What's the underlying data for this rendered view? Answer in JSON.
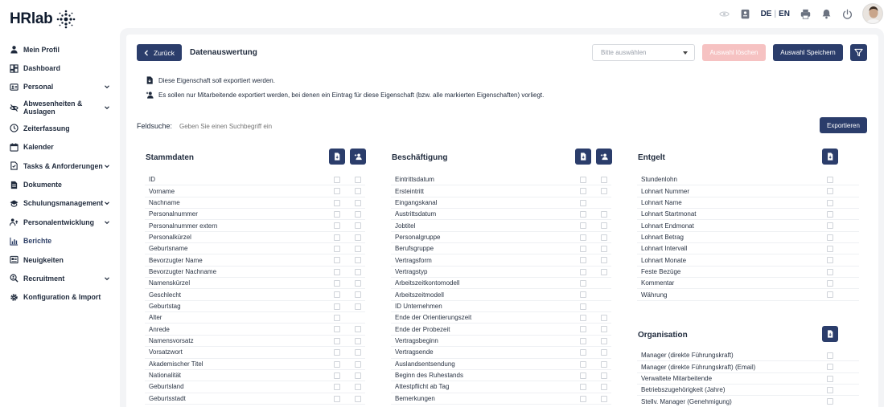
{
  "brand": {
    "name": "HRlab",
    "accent": "#2b3d6b",
    "danger_soft": "#f6c2c2"
  },
  "topbar": {
    "icons": [
      "eye-icon",
      "id-card-icon",
      "printer-icon",
      "bell-icon",
      "power-icon"
    ],
    "lang_de": "DE",
    "lang_sep": "|",
    "lang_en": "EN"
  },
  "sidebar": {
    "items": [
      {
        "label": "Mein Profil",
        "icon": "user-icon",
        "chevron": false
      },
      {
        "label": "Dashboard",
        "icon": "dashboard-icon",
        "chevron": false
      },
      {
        "label": "Personal",
        "icon": "people-icon",
        "chevron": true
      },
      {
        "label": "Abwesenheiten & Auslagen",
        "icon": "eye-off-icon",
        "chevron": true
      },
      {
        "label": "Zeiterfassung",
        "icon": "clock-icon",
        "chevron": false
      },
      {
        "label": "Kalender",
        "icon": "calendar-icon",
        "chevron": false
      },
      {
        "label": "Tasks & Anforderungen",
        "icon": "tasks-icon",
        "chevron": true
      },
      {
        "label": "Dokumente",
        "icon": "document-icon",
        "chevron": false
      },
      {
        "label": "Schulungsmanagement",
        "icon": "graduation-icon",
        "chevron": true
      },
      {
        "label": "Personalentwicklung",
        "icon": "growth-icon",
        "chevron": true
      },
      {
        "label": "Berichte",
        "icon": "chart-icon",
        "chevron": false,
        "active": true
      },
      {
        "label": "Neuigkeiten",
        "icon": "news-icon",
        "chevron": false
      },
      {
        "label": "Recruitment",
        "icon": "search-person-icon",
        "chevron": true
      },
      {
        "label": "Konfiguration & Import",
        "icon": "gear-icon",
        "chevron": false
      }
    ]
  },
  "toolbar": {
    "back_label": "Zurück",
    "title": "Datenauswertung",
    "select_placeholder": "Bitte auswählen",
    "delete_label": "Auswahl löschen",
    "save_label": "Auswahl Speichern"
  },
  "legend": {
    "export_text": "Diese Eigenschaft soll exportiert werden.",
    "filter_text": "Es sollen nur Mitarbeitende exportiert werden, bei denen ein Eintrag für diese Eigenschaft (bzw. alle markierten Eigenschaften) vorliegt."
  },
  "search": {
    "label": "Feldsuche:",
    "placeholder": "Geben Sie einen Suchbegriff ein",
    "export_label": "Exportieren"
  },
  "sections": {
    "stammdaten": {
      "title": "Stammdaten",
      "rows": [
        {
          "label": "ID",
          "second": true
        },
        {
          "label": "Vorname",
          "second": true
        },
        {
          "label": "Nachname",
          "second": true
        },
        {
          "label": "Personalnummer",
          "second": true
        },
        {
          "label": "Personalnummer extern",
          "second": true
        },
        {
          "label": "Personalkürzel",
          "second": true
        },
        {
          "label": "Geburtsname",
          "second": true
        },
        {
          "label": "Bevorzugter Name",
          "second": true
        },
        {
          "label": "Bevorzugter Nachname",
          "second": true
        },
        {
          "label": "Namenskürzel",
          "second": true
        },
        {
          "label": "Geschlecht",
          "second": true
        },
        {
          "label": "Geburtstag",
          "second": true
        },
        {
          "label": "Alter",
          "second": false
        },
        {
          "label": "Anrede",
          "second": true
        },
        {
          "label": "Namensvorsatz",
          "second": true
        },
        {
          "label": "Vorsatzwort",
          "second": true
        },
        {
          "label": "Akademischer Titel",
          "second": true
        },
        {
          "label": "Nationalität",
          "second": true
        },
        {
          "label": "Geburtsland",
          "second": true
        },
        {
          "label": "Geburtsstadt",
          "second": true
        }
      ]
    },
    "beschaeftigung": {
      "title": "Beschäftigung",
      "rows": [
        {
          "label": "Eintrittsdatum",
          "second": true
        },
        {
          "label": "Ersteintritt",
          "second": true
        },
        {
          "label": "Eingangskanal",
          "second": false
        },
        {
          "label": "Austrittsdatum",
          "second": true
        },
        {
          "label": "Jobtitel",
          "second": true
        },
        {
          "label": "Personalgruppe",
          "second": true
        },
        {
          "label": "Berufsgruppe",
          "second": true
        },
        {
          "label": "Vertragsform",
          "second": true
        },
        {
          "label": "Vertragstyp",
          "second": true
        },
        {
          "label": "Arbeitszeitkontomodell",
          "second": false
        },
        {
          "label": "Arbeitszeitmodell",
          "second": false
        },
        {
          "label": "ID Unternehmen",
          "second": false
        },
        {
          "label": "Ende der Orientierungszeit",
          "second": true
        },
        {
          "label": "Ende der Probezeit",
          "second": true
        },
        {
          "label": "Vertragsbeginn",
          "second": true
        },
        {
          "label": "Vertragsende",
          "second": true
        },
        {
          "label": "Auslandsentsendung",
          "second": true
        },
        {
          "label": "Beginn des Ruhestands",
          "second": true
        },
        {
          "label": "Attestpflicht ab Tag",
          "second": true
        },
        {
          "label": "Bemerkungen",
          "second": true
        }
      ]
    },
    "entgelt": {
      "title": "Entgelt",
      "rows": [
        {
          "label": "Stundenlohn"
        },
        {
          "label": "Lohnart Nummer"
        },
        {
          "label": "Lohnart Name"
        },
        {
          "label": "Lohnart Startmonat"
        },
        {
          "label": "Lohnart Endmonat"
        },
        {
          "label": "Lohnart Betrag"
        },
        {
          "label": "Lohnart Intervall"
        },
        {
          "label": "Lohnart Monate"
        },
        {
          "label": "Feste Bezüge"
        },
        {
          "label": "Kommentar"
        },
        {
          "label": "Währung"
        }
      ]
    },
    "organisation": {
      "title": "Organisation",
      "rows": [
        {
          "label": "Manager (direkte Führungskraft)"
        },
        {
          "label": "Manager (direkte Führungskraft) (Email)"
        },
        {
          "label": "Verwaltete Mitarbeitende"
        },
        {
          "label": "Betriebszugehörigkeit (Jahre)"
        },
        {
          "label": "Stellv. Manager (Genehmigung)"
        }
      ]
    }
  }
}
